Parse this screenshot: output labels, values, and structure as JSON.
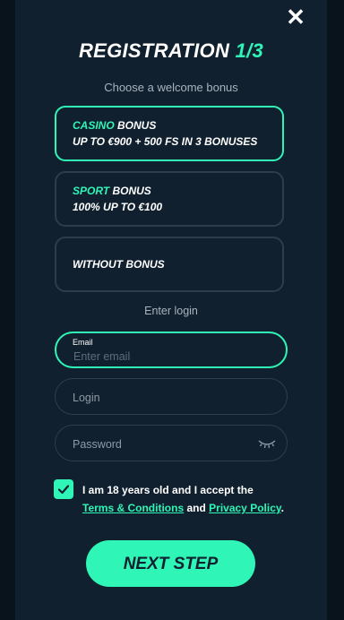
{
  "modal": {
    "close_label": "✕",
    "title_main": "REGISTRATION",
    "title_step": "1/3",
    "subtitle": "Choose a welcome bonus"
  },
  "bonuses": [
    {
      "tag": "CASINO",
      "title": "BONUS",
      "description": "UP TO €900 + 500 FS IN 3 BONUSES",
      "selected": true
    },
    {
      "tag": "SPORT",
      "title": "BONUS",
      "description": "100% UP TO €100",
      "selected": false
    },
    {
      "tag": "",
      "title": "WITHOUT BONUS",
      "description": "",
      "selected": false
    }
  ],
  "login_section": {
    "label": "Enter login",
    "email": {
      "label": "Email",
      "placeholder": "Enter email",
      "value": ""
    },
    "login": {
      "placeholder": "Login",
      "value": ""
    },
    "password": {
      "placeholder": "Password",
      "value": ""
    }
  },
  "consent": {
    "checked": true,
    "text_before": "I am 18 years old and I accept the",
    "terms_link": "Terms & Conditions",
    "and": "and",
    "privacy_link": "Privacy Policy",
    "end": "."
  },
  "next_button": "NEXT STEP",
  "colors": {
    "accent": "#2ff5b6",
    "background": "#10202e",
    "border": "#2c3d4d"
  },
  "icons": {
    "close": "close-icon",
    "password_toggle": "eye-closed-icon",
    "checkbox": "checkmark-icon"
  }
}
